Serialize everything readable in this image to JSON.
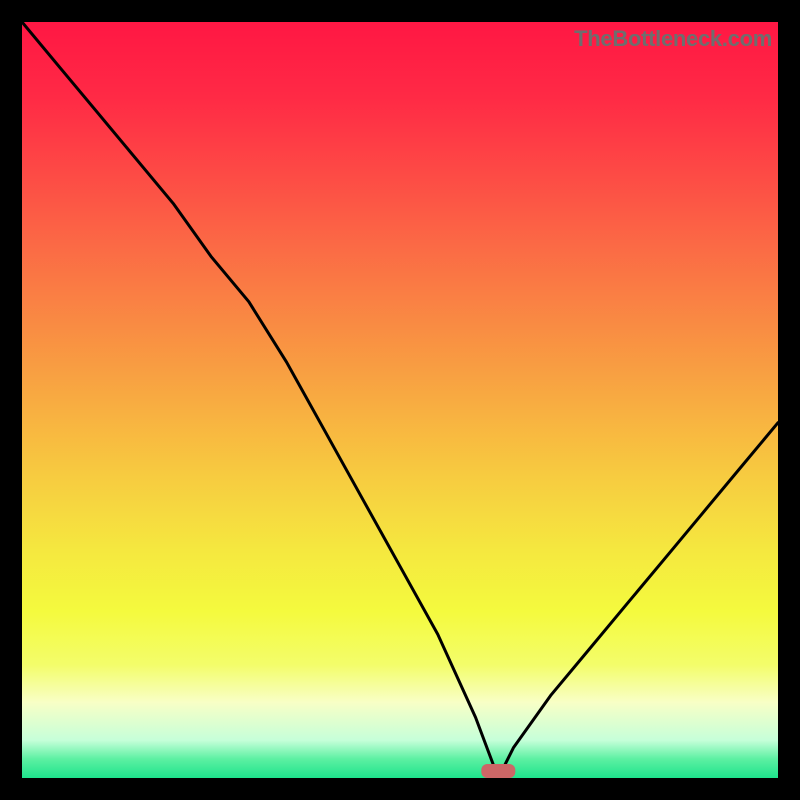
{
  "watermark": "TheBottleneck.com",
  "chart_data": {
    "type": "line",
    "title": "",
    "xlabel": "",
    "ylabel": "",
    "x": [
      0,
      5,
      10,
      15,
      20,
      25,
      30,
      35,
      40,
      45,
      50,
      55,
      60,
      63,
      65,
      70,
      75,
      80,
      85,
      90,
      95,
      100
    ],
    "values": [
      100,
      94,
      88,
      82,
      76,
      69,
      63,
      55,
      46,
      37,
      28,
      19,
      8,
      0,
      4,
      11,
      17,
      23,
      29,
      35,
      41,
      47
    ],
    "xlim": [
      0,
      100
    ],
    "ylim": [
      0,
      100
    ],
    "optimal_x": 63,
    "gradient_stops": [
      {
        "offset": 0.0,
        "color": "#ff1744"
      },
      {
        "offset": 0.1,
        "color": "#ff2a45"
      },
      {
        "offset": 0.2,
        "color": "#fd4a45"
      },
      {
        "offset": 0.3,
        "color": "#fb6b45"
      },
      {
        "offset": 0.4,
        "color": "#f98b43"
      },
      {
        "offset": 0.5,
        "color": "#f8ab41"
      },
      {
        "offset": 0.6,
        "color": "#f7cb40"
      },
      {
        "offset": 0.7,
        "color": "#f5e83f"
      },
      {
        "offset": 0.78,
        "color": "#f4fa3e"
      },
      {
        "offset": 0.85,
        "color": "#f3fd6a"
      },
      {
        "offset": 0.9,
        "color": "#f8ffc6"
      },
      {
        "offset": 0.95,
        "color": "#c6ffd9"
      },
      {
        "offset": 0.975,
        "color": "#5cf0a2"
      },
      {
        "offset": 1.0,
        "color": "#1ee38c"
      }
    ],
    "marker_color": "#cc6666"
  }
}
